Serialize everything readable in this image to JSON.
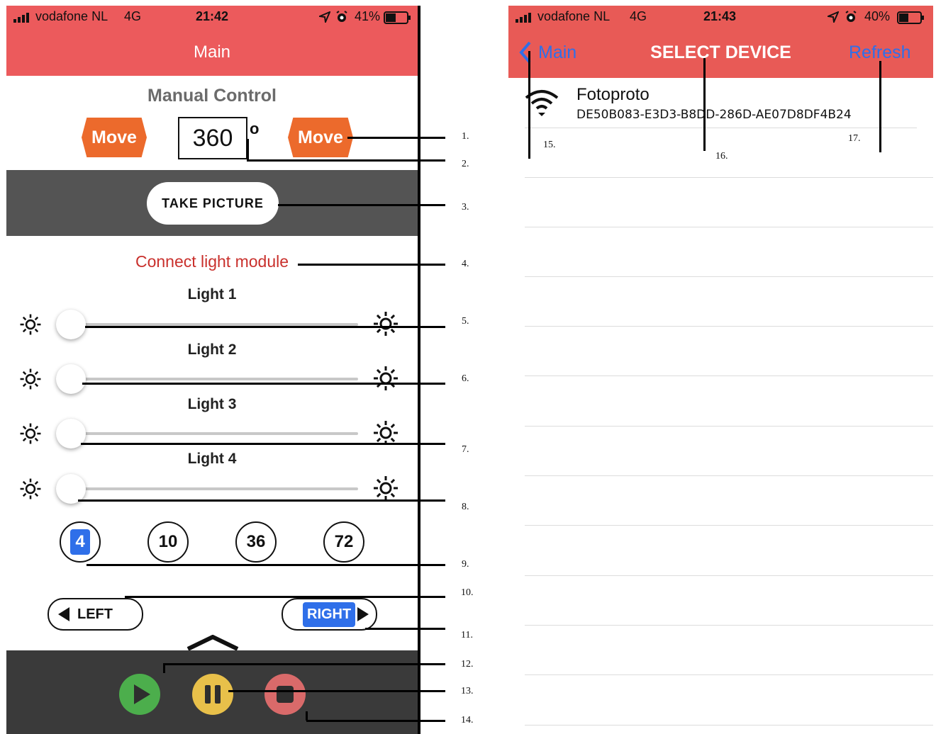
{
  "left_screen": {
    "status": {
      "carrier": "vodafone NL",
      "network": "4G",
      "time": "21:42",
      "battery": "41%"
    },
    "nav_title": "Main",
    "manual_control": {
      "title": "Manual Control",
      "move_left_label": "Move",
      "move_right_label": "Move",
      "degree_value": "360",
      "degree_symbol": "o"
    },
    "take_picture_label": "TAKE PICTURE",
    "connect_light_label": "Connect light module",
    "lights": [
      {
        "label": "Light 1",
        "value": 0
      },
      {
        "label": "Light 2",
        "value": 0
      },
      {
        "label": "Light 3",
        "value": 0
      },
      {
        "label": "Light 4",
        "value": 0
      }
    ],
    "step_options": [
      {
        "label": "4",
        "selected": true
      },
      {
        "label": "10",
        "selected": false
      },
      {
        "label": "36",
        "selected": false
      },
      {
        "label": "72",
        "selected": false
      }
    ],
    "direction": {
      "left_label": "LEFT",
      "right_label": "RIGHT",
      "selected": "right"
    },
    "media": {
      "play_color": "#4cae4c",
      "pause_color": "#e8c04a",
      "stop_color": "#d96a6a"
    }
  },
  "right_screen": {
    "status": {
      "carrier": "vodafone NL",
      "network": "4G",
      "time": "21:43",
      "battery": "40%"
    },
    "back_label": "Main",
    "title": "SELECT DEVICE",
    "refresh_label": "Refresh",
    "devices": [
      {
        "name": "Fotoproto",
        "uuid": "DE50B083-E3D3-B8DD-286D-AE07D8DF4B24",
        "icon": "wifi-icon"
      }
    ]
  },
  "callouts": [
    "1.",
    "2.",
    "3.",
    "4.",
    "5.",
    "6.",
    "7.",
    "8.",
    "9.",
    "10.",
    "11.",
    "12.",
    "13.",
    "14.",
    "15.",
    "16.",
    "17."
  ],
  "colors": {
    "nav_red": "#ec5a5c",
    "move_orange": "#ec6a2c",
    "connect_red": "#c9302c",
    "ios_blue": "#2f6fe9",
    "dark_panel": "#545454",
    "bottom_panel": "#3a3a3a"
  }
}
